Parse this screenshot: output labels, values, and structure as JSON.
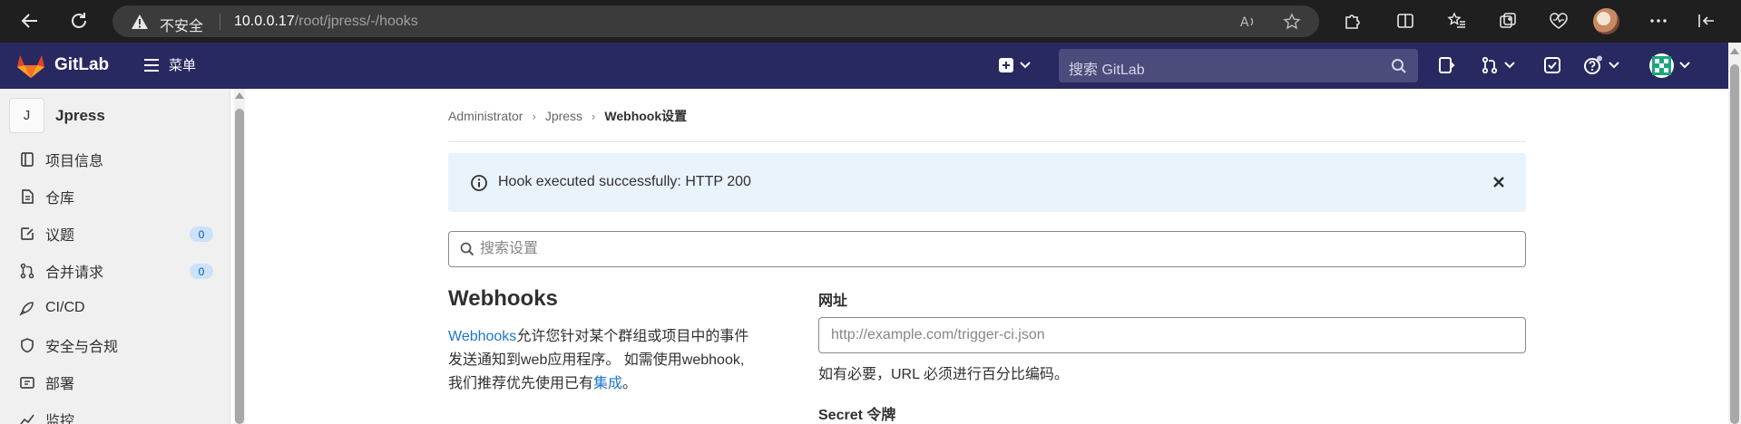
{
  "browser": {
    "insecure_label": "不安全",
    "url_host": "10.0.0.17",
    "url_path": "/root/jpress/-/hooks"
  },
  "navbar": {
    "brand": "GitLab",
    "menu_label": "菜单",
    "search_placeholder": "搜索 GitLab"
  },
  "sidebar": {
    "project_initial": "J",
    "project_name": "Jpress",
    "items": [
      {
        "label": "项目信息",
        "icon": "project-info-icon"
      },
      {
        "label": "仓库",
        "icon": "repository-icon"
      },
      {
        "label": "议题",
        "icon": "issues-icon",
        "badge": "0"
      },
      {
        "label": "合并请求",
        "icon": "merge-request-icon",
        "badge": "0"
      },
      {
        "label": "CI/CD",
        "icon": "rocket-icon"
      },
      {
        "label": "安全与合规",
        "icon": "shield-icon"
      },
      {
        "label": "部署",
        "icon": "deployments-icon"
      },
      {
        "label": "监控",
        "icon": "monitor-icon"
      }
    ]
  },
  "breadcrumb": {
    "items": [
      "Administrator",
      "Jpress",
      "Webhook设置"
    ]
  },
  "alert": {
    "message": "Hook executed successfully: HTTP 200"
  },
  "settings_search": {
    "placeholder": "搜索设置"
  },
  "webhooks": {
    "title": "Webhooks",
    "desc_link": "Webhooks",
    "desc_line1": "允许您针对某个群组或项目中的事件",
    "desc_line2": "发送通知到web应用程序。 如需使用webhook,",
    "desc_line3": "我们推荐优先使用已有",
    "desc_link2": "集成",
    "desc_end": "。"
  },
  "form": {
    "url_label": "网址",
    "url_placeholder": "http://example.com/trigger-ci.json",
    "url_help": "如有必要，URL 必须进行百分比编码。",
    "secret_label": "Secret 令牌"
  },
  "colors": {
    "navbar_bg": "#292961",
    "link": "#1f75cb",
    "alert_bg": "#e9f3fc",
    "badge_bg": "#cbe2f9"
  }
}
